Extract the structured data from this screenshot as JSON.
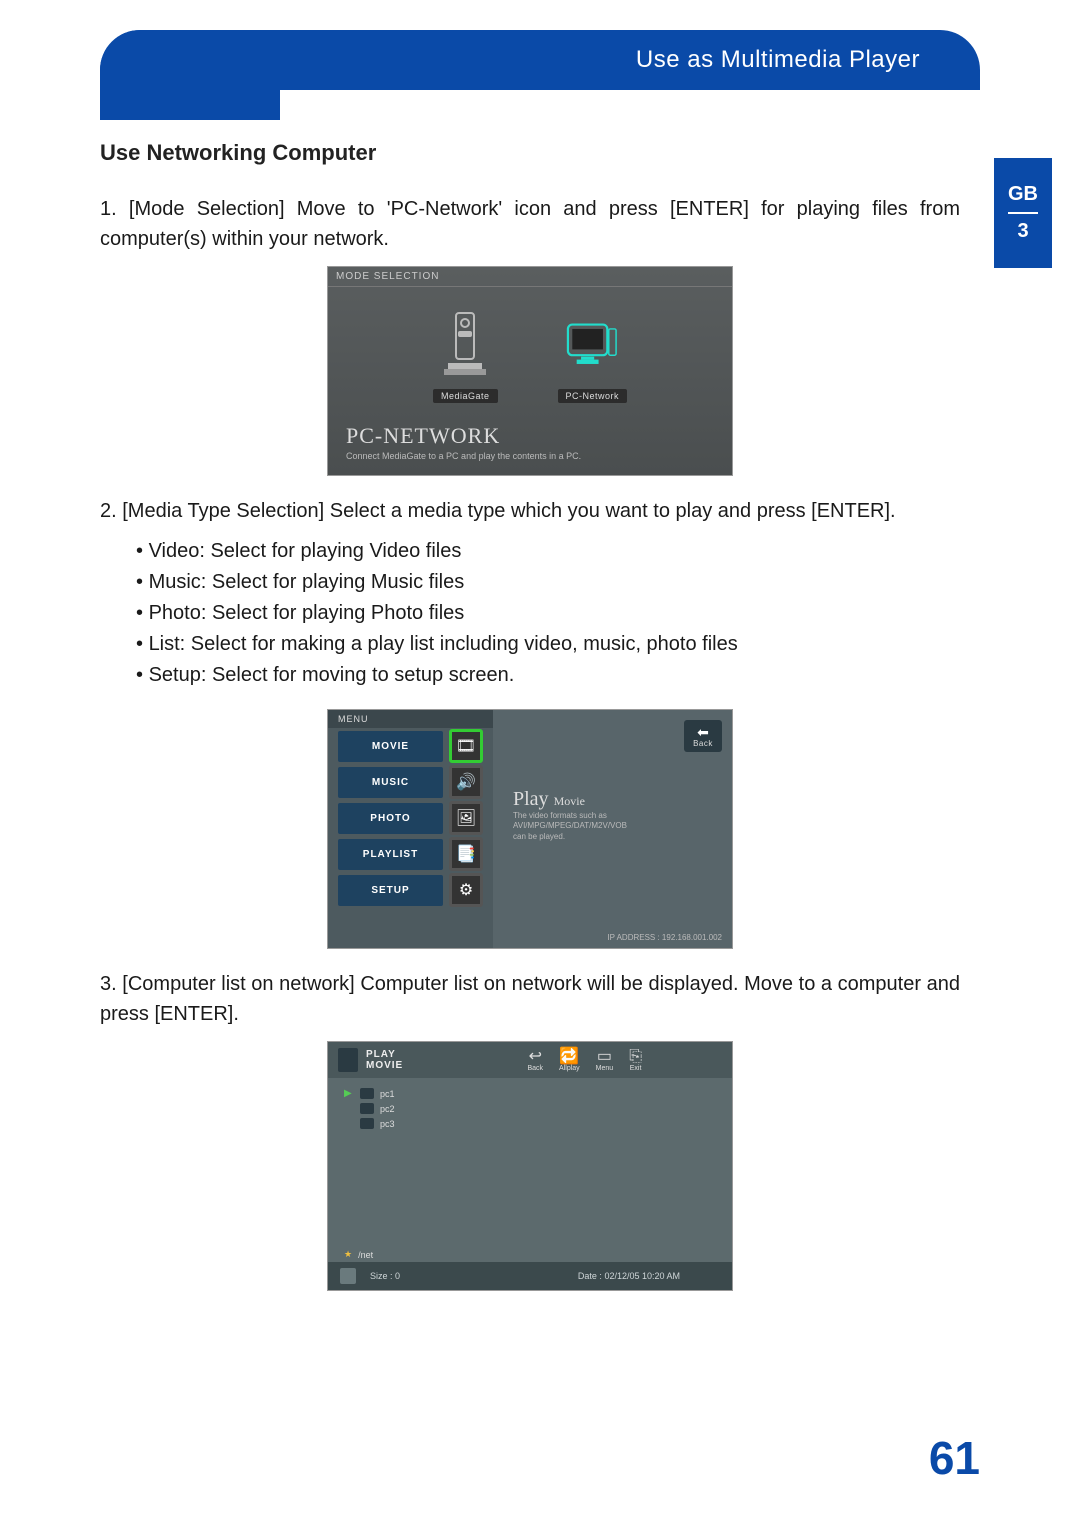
{
  "header": {
    "title": "Use as Multimedia Player"
  },
  "side_tab": {
    "lang": "GB",
    "num": "3"
  },
  "section": {
    "heading": "Use Networking Computer"
  },
  "steps": {
    "s1": "[Mode Selection] Move to 'PC-Network' icon and press [ENTER] for playing files from computer(s) within your network.",
    "s2": "[Media Type Selection] Select a media type which you want to play and press [ENTER].",
    "s3": "[Computer list on network] Computer list on network will be displayed. Move to a computer and press [ENTER]."
  },
  "media_types": {
    "video": "Video: Select for playing Video files",
    "music": "Music: Select for playing Music files",
    "photo": "Photo: Select for playing Photo files",
    "list": "List: Select for making a play list including video, music, photo files",
    "setup": "Setup: Select for moving to setup screen."
  },
  "ss1": {
    "title": "MODE SELECTION",
    "mediagate": "MediaGate",
    "pcnetwork": "PC-Network",
    "big": "PC-NETWORK",
    "sub": "Connect MediaGate to a PC and play the contents in a PC."
  },
  "ss2": {
    "menuhead": "MENU",
    "items": {
      "movie": "MOVIE",
      "music": "MUSIC",
      "photo": "PHOTO",
      "playlist": "PLAYLIST",
      "setup": "SETUP"
    },
    "back": "Back",
    "play": "Play",
    "play_sub": "Movie",
    "desc1": "The video formats such as",
    "desc2": "AVI/MPG/MPEG/DAT/M2V/VOB",
    "desc3": "can be played.",
    "ip": "IP ADDRESS : 192.168.001.002"
  },
  "ss3": {
    "title1": "PLAY",
    "title2": "MOVIE",
    "tb": {
      "back": "Back",
      "allplay": "Allplay",
      "menu": "Menu",
      "exit": "Exit"
    },
    "files": {
      "f1": "pc1",
      "f2": "pc2",
      "f3": "pc3"
    },
    "path": "/net",
    "size_lbl": "Size :",
    "size_val": "0",
    "date_lbl": "Date :",
    "date_val": "02/12/05 10:20 AM"
  },
  "page_number": "61"
}
